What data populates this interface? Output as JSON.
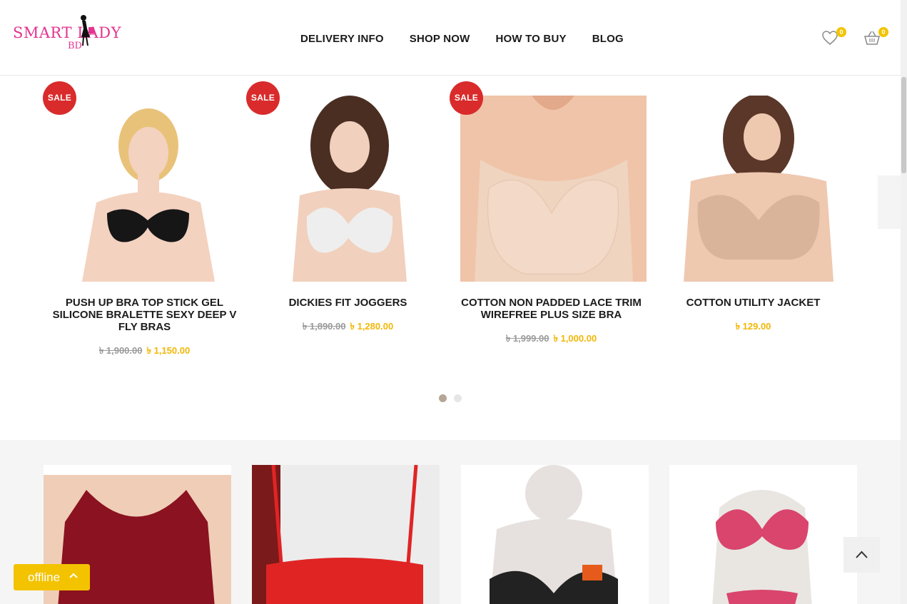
{
  "header": {
    "logo": {
      "text": "SMART LADY",
      "sub": "BD"
    },
    "nav": [
      "DELIVERY INFO",
      "SHOP NOW",
      "HOW TO BUY",
      "BLOG"
    ],
    "wishlist_count": "0",
    "cart_count": "0"
  },
  "products": [
    {
      "title": "PUSH UP BRA TOP STICK GEL SILICONE BRALETTE SEXY DEEP V FLY BRAS",
      "sale": "SALE",
      "old_price": "৳ 1,900.00",
      "price": "৳ 1,150.00"
    },
    {
      "title": "DICKIES FIT JOGGERS",
      "sale": "SALE",
      "old_price": "৳ 1,890.00",
      "price": "৳ 1,280.00"
    },
    {
      "title": "COTTON NON PADDED LACE TRIM WIREFREE PLUS SIZE BRA",
      "sale": "SALE",
      "old_price": "৳ 1,999.00",
      "price": "৳ 1,000.00"
    },
    {
      "title": "COTTON UTILITY JACKET",
      "sale": "",
      "old_price": "",
      "price": "৳ 129.00"
    }
  ],
  "carousel": {
    "pages": 2,
    "active_page": 1
  },
  "chat": {
    "status": "offline"
  },
  "colors": {
    "brand": "#e4348f",
    "sale": "#d92b2b",
    "price": "#f2b705",
    "chat": "#f3c300"
  }
}
